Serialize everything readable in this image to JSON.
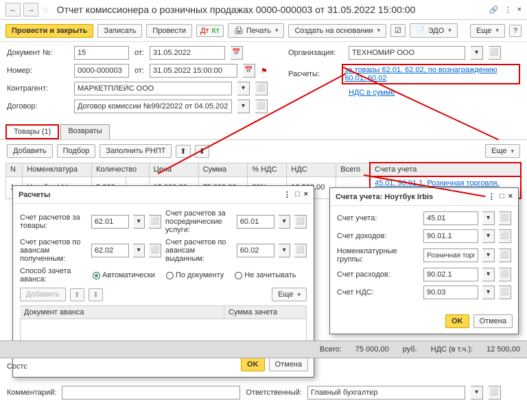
{
  "title": "Отчет комиссионера о розничных продажах 0000-000003 от 31.05.2022 15:00:00",
  "toolbar": {
    "post_close": "Провести и закрыть",
    "write": "Записать",
    "post": "Провести",
    "print": "Печать",
    "create_based": "Создать на основании",
    "edo": "ЭДО",
    "more": "Еще"
  },
  "form": {
    "doc_num_lbl": "Документ №:",
    "doc_num": "15",
    "from_lbl": "от:",
    "doc_date": "31.05.2022",
    "org_lbl": "Организация:",
    "org": "ТЕХНОМИР ООО",
    "num_lbl": "Номер:",
    "num": "0000-000003",
    "num_date": "31.05.2022 15:00:00",
    "calc_lbl": "Расчеты:",
    "calc_link": "за товары 62.01, 62.02, по вознаграждению 60.01, 60.02",
    "contr_lbl": "Контрагент:",
    "contr": "МАРКЕТПЛЕЙС ООО",
    "vat_link": "НДС в сумме",
    "contract_lbl": "Договор:",
    "contract": "Договор комиссии №99/22022 от 04.05.2022"
  },
  "tabs": {
    "goods": "Товары (1)",
    "returns": "Возвраты"
  },
  "subbar": {
    "add": "Добавить",
    "select": "Подбор",
    "fill": "Заполнить РНПТ",
    "more": "Еще"
  },
  "table": {
    "headers": {
      "n": "N",
      "nom": "Номенклатура",
      "qty": "Количество",
      "price": "Цена",
      "sum": "Сумма",
      "vat_pct": "% НДС",
      "vat": "НДС",
      "total": "Всего",
      "accts": "Счета учета"
    },
    "row": {
      "n": "1",
      "nom": "Ноутбук Irbis",
      "qty": "5,000",
      "unit": "шт",
      "price": "15 000,00",
      "sum": "75 000,00",
      "vat_pct": "20%",
      "vat": "12 500,00",
      "accts": "45.01, 90.01.1, Розничная торговля, 90.02.1, 90.03"
    }
  },
  "popup_calc": {
    "title": "Расчеты",
    "acct_goods_lbl": "Счет расчетов за товары:",
    "acct_goods": "62.01",
    "acct_serv_lbl": "Счет расчетов за посреднические услуги:",
    "acct_serv": "60.01",
    "acct_adv_rec_lbl": "Счет расчетов по авансам полученным:",
    "acct_adv_rec": "62.02",
    "acct_adv_pay_lbl": "Счет расчетов по авансам выданным:",
    "acct_adv_pay": "60.02",
    "method_lbl": "Способ зачета аванса:",
    "method_auto": "Автоматически",
    "method_doc": "По документу",
    "method_none": "Не зачитывать",
    "add": "Добавить",
    "more": "Еще",
    "col1": "Документ аванса",
    "col2": "Сумма зачета",
    "ok": "OK",
    "cancel": "Отмена"
  },
  "popup_acct": {
    "title": "Счета учета: Ноутбук Irbis",
    "acct_lbl": "Счет учета:",
    "acct": "45.01",
    "income_lbl": "Счет доходов:",
    "income": "90.01.1",
    "nomgrp_lbl": "Номенклатурные группы:",
    "nomgrp": "Розничная торговля",
    "exp_lbl": "Счет расходов:",
    "exp": "90.02.1",
    "vat_lbl": "Счет НДС:",
    "vat": "90.03",
    "ok": "OK",
    "cancel": "Отмена"
  },
  "totals": {
    "total_lbl": "Всего:",
    "total": "75 000,00",
    "cur": "руб.",
    "vat_lbl": "НДС (в т.ч.):",
    "vat": "12 500,00"
  },
  "footer": {
    "state_lbl": "Состс",
    "comment_lbl": "Комментарий:",
    "resp_lbl": "Ответственный:",
    "resp": "Главный бухгалтер"
  }
}
